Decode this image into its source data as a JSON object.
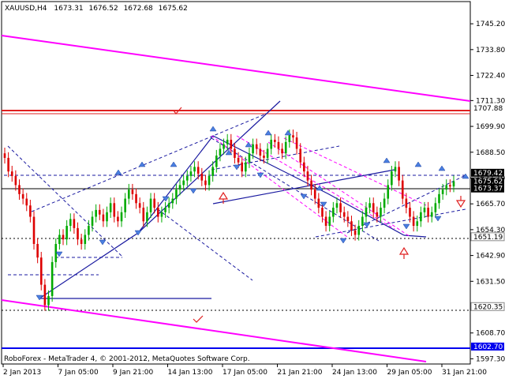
{
  "header": {
    "symbol": "XAUUSD,H4",
    "open": "1673.31",
    "high": "1676.52",
    "low": "1672.68",
    "close": "1675.62"
  },
  "footer": {
    "copyright": "RoboForex - MetaTrader 4, © 2001-2012, MetaQuotes Software Corp."
  },
  "colors": {
    "bull": "#00aa00",
    "bear": "#dd0000",
    "trend": "#ff00ff",
    "structure": "#1a1aa0",
    "resistance": "#e02020",
    "support": "#0000ee",
    "arrow": "#4a7fe0"
  },
  "chart_data": {
    "type": "candlestick",
    "symbol": "XAUUSD",
    "timeframe": "H4",
    "ylim": [
      1595,
      1755
    ],
    "y_ticks": [
      "1745.20",
      "1733.80",
      "1722.40",
      "1711.30",
      "1699.90",
      "1688.50",
      "1677.10",
      "1665.70",
      "1654.30",
      "1642.90",
      "1631.50",
      "1620.10",
      "1608.70",
      "1597.30"
    ],
    "x_ticks": [
      "2 Jan 2013",
      "7 Jan 05:00",
      "9 Jan 21:00",
      "14 Jan 13:00",
      "17 Jan 05:00",
      "21 Jan 21:00",
      "24 Jan 13:00",
      "29 Jan 05:00",
      "31 Jan 21:00"
    ],
    "price_tags": [
      {
        "value": "1707.88",
        "kind": "resistance"
      },
      {
        "value": "1679.42",
        "kind": "current"
      },
      {
        "value": "1675.62",
        "kind": "current"
      },
      {
        "value": "1673.37",
        "kind": "current"
      },
      {
        "value": "1651.19",
        "kind": "level"
      },
      {
        "value": "1620.35",
        "kind": "level"
      },
      {
        "value": "1602.70",
        "kind": "support"
      }
    ],
    "closes": [
      1686,
      1680,
      1678,
      1674,
      1670,
      1668,
      1665,
      1660,
      1648,
      1642,
      1630,
      1621,
      1625,
      1640,
      1648,
      1652,
      1650,
      1656,
      1659,
      1655,
      1650,
      1648,
      1652,
      1656,
      1660,
      1663,
      1661,
      1658,
      1662,
      1666,
      1660,
      1658,
      1662,
      1668,
      1672,
      1670,
      1666,
      1664,
      1658,
      1662,
      1668,
      1664,
      1660,
      1662,
      1664,
      1666,
      1668,
      1672,
      1674,
      1676,
      1678,
      1680,
      1682,
      1679,
      1676,
      1674,
      1678,
      1682,
      1687,
      1690,
      1692,
      1694,
      1690,
      1686,
      1684,
      1680,
      1684,
      1688,
      1692,
      1690,
      1687,
      1686,
      1690,
      1694,
      1693,
      1690,
      1688,
      1693,
      1696,
      1695,
      1690,
      1684,
      1680,
      1676,
      1672,
      1668,
      1664,
      1660,
      1656,
      1660,
      1664,
      1666,
      1662,
      1660,
      1658,
      1654,
      1652,
      1656,
      1660,
      1664,
      1666,
      1662,
      1660,
      1664,
      1668,
      1674,
      1680,
      1682,
      1676,
      1668,
      1664,
      1660,
      1656,
      1658,
      1662,
      1664,
      1660,
      1662,
      1666,
      1670,
      1672,
      1674,
      1673.37,
      1675.62
    ]
  }
}
